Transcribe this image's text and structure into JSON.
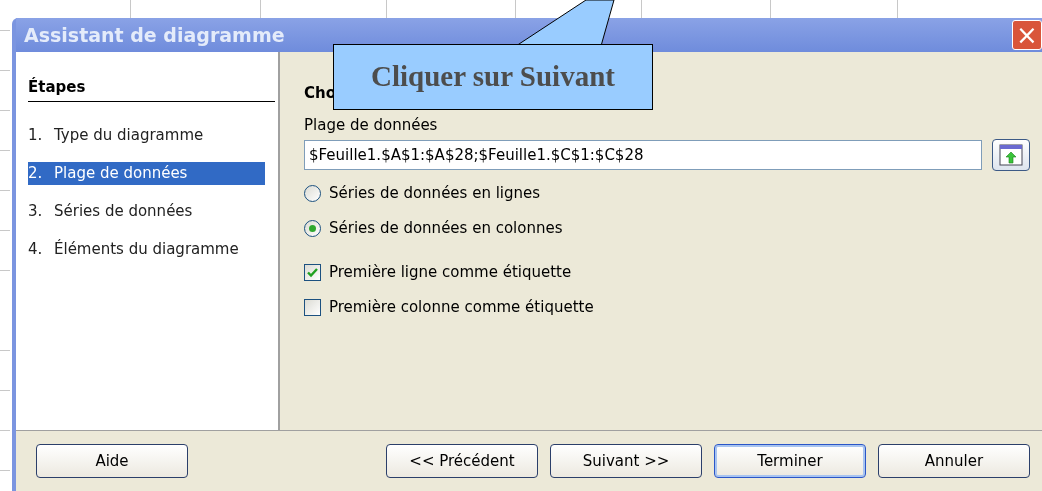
{
  "window": {
    "title": "Assistant de diagramme",
    "close": "×"
  },
  "steps": {
    "heading": "Étapes",
    "items": [
      {
        "number": "1.",
        "label": "Type du diagramme",
        "selected": false
      },
      {
        "number": "2.",
        "label": "Plage de données",
        "selected": true
      },
      {
        "number": "3.",
        "label": "Séries de données",
        "selected": false
      },
      {
        "number": "4.",
        "label": "Éléments du diagramme",
        "selected": false
      }
    ]
  },
  "content": {
    "heading": "Cho",
    "range_label": "Plage de données",
    "range_value": "$Feuille1.$A$1:$A$28;$Feuille1.$C$1:$C$28",
    "series": [
      {
        "label": "Séries de données en lignes",
        "selected": false
      },
      {
        "label": "Séries de données en colonnes",
        "selected": true
      }
    ],
    "options": [
      {
        "label": "Première ligne comme étiquette",
        "checked": true
      },
      {
        "label": "Première colonne comme étiquette",
        "checked": false
      }
    ]
  },
  "callout": "Cliquer sur Suivant",
  "buttons": [
    {
      "label": "Aide",
      "default": false
    },
    {
      "label": "<< Précédent",
      "default": false
    },
    {
      "label": "Suivant >>",
      "default": false
    },
    {
      "label": "Terminer",
      "default": true
    },
    {
      "label": "Annuler",
      "default": false
    }
  ]
}
